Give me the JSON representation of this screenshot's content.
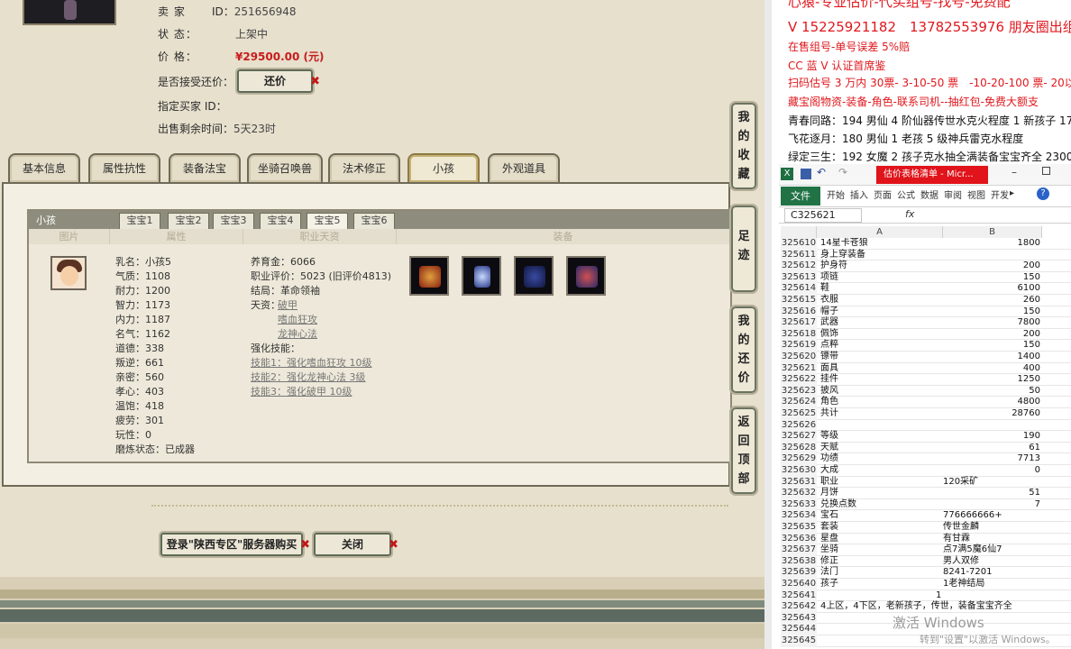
{
  "seller": {
    "label": "卖 家",
    "id_label": "ID：",
    "id": "251656948"
  },
  "status": {
    "label": "状 态：",
    "value": "上架中"
  },
  "price": {
    "label": "价 格：",
    "value": "¥29500.00 (元)"
  },
  "bargain": {
    "label": "是否接受还价：",
    "button": "还价"
  },
  "buyer": {
    "label": "指定买家 ID："
  },
  "remain": {
    "label": "出售剩余时间：",
    "value": "5天23时"
  },
  "tabs": [
    "基本信息",
    "属性抗性",
    "装备法宝",
    "坐骑召唤兽",
    "法术修正",
    "小孩",
    "外观道具"
  ],
  "kid": {
    "title": "小孩",
    "subtabs": [
      "宝宝1",
      "宝宝2",
      "宝宝3",
      "宝宝4",
      "宝宝5",
      "宝宝6"
    ],
    "columns": [
      "图片",
      "属性",
      "职业天资",
      "装备"
    ],
    "stats": [
      {
        "k": "乳名：",
        "v": "小孩5"
      },
      {
        "k": "气质：",
        "v": "1108"
      },
      {
        "k": "耐力：",
        "v": "1200"
      },
      {
        "k": "智力：",
        "v": "1173"
      },
      {
        "k": "内力：",
        "v": "1187"
      },
      {
        "k": "名气：",
        "v": "1162"
      },
      {
        "k": "道德：",
        "v": "338"
      },
      {
        "k": "叛逆：",
        "v": "661"
      },
      {
        "k": "亲密：",
        "v": "560"
      },
      {
        "k": "孝心：",
        "v": "403"
      },
      {
        "k": "温饱：",
        "v": "418"
      },
      {
        "k": "疲劳：",
        "v": "301"
      },
      {
        "k": "玩性：",
        "v": "0"
      },
      {
        "k": "磨炼状态：",
        "v": "已成器"
      }
    ],
    "career": {
      "money": {
        "k": "养育金：",
        "v": "6066"
      },
      "rating": {
        "k": "职业评价：",
        "v": "5023 (旧评价4813)"
      },
      "ending": {
        "k": "结局：",
        "v": "革命领袖"
      },
      "talent_label": "天资：",
      "talents": [
        "破甲",
        "嗜血狂攻",
        "龙神心法"
      ],
      "skill_label": "强化技能：",
      "skills": [
        "技能1：强化嗜血狂攻 10级",
        "技能2：强化龙神心法 3级",
        "技能3：强化破甲 10级"
      ]
    }
  },
  "buttons": {
    "buy": "登录\"陕西专区\"服务器购买",
    "close": "关闭"
  },
  "side_buttons": [
    "我的收藏",
    "足迹",
    "我的还价",
    "返回顶部"
  ],
  "ads": {
    "line0": "心猿-专业估价-代买组号-找号-免费配",
    "line1": "V 15225921182　13782553976 朋友圈出组号",
    "line2": "在售组号-单号误差 5%赔",
    "line3": "CC 蓝 V 认证首席鉴",
    "line4": "扫码估号 3 万内 30票- 3-10-50 票　-10-20-100 票- 20以上 150",
    "line5": "藏宝阁物资-装备-角色-联系司机--抽红包-免费大额支",
    "line6": "青春同路：194 男仙 4 阶仙器传世水克火程度 1 新孩子 17500",
    "line7": "飞花逐月：180 男仙 1 老孩 5 级神兵雷克水程度",
    "line8": "绿定三生：192 女魔 2 孩子克水抽全满装备宝宝齐全 23000"
  },
  "excel": {
    "title": "估价表格清单 - Micr...",
    "file_tab": "文件",
    "ribbon": [
      "开始",
      "插入",
      "页面",
      "公式",
      "数据",
      "审阅",
      "视图",
      "开发"
    ],
    "name_box": "C325621",
    "fx": "fx",
    "col_a": "A",
    "col_b": "B",
    "rows": [
      {
        "n": "325610",
        "a": "14星卡苍狼",
        "b": "1800"
      },
      {
        "n": "325611",
        "a": "身上穿装备",
        "b": ""
      },
      {
        "n": "325612",
        "a": "护身符",
        "b": "200"
      },
      {
        "n": "325613",
        "a": "项链",
        "b": "150"
      },
      {
        "n": "325614",
        "a": "鞋",
        "b": "6100"
      },
      {
        "n": "325615",
        "a": "衣服",
        "b": "260"
      },
      {
        "n": "325616",
        "a": "帽子",
        "b": "150"
      },
      {
        "n": "325617",
        "a": "武器",
        "b": "7800"
      },
      {
        "n": "325618",
        "a": "佩饰",
        "b": "200"
      },
      {
        "n": "325619",
        "a": "点粹",
        "b": "150"
      },
      {
        "n": "325620",
        "a": "镖带",
        "b": "1400"
      },
      {
        "n": "325621",
        "a": "面具",
        "b": "400"
      },
      {
        "n": "325622",
        "a": "挂件",
        "b": "1250"
      },
      {
        "n": "325623",
        "a": "披风",
        "b": "50"
      },
      {
        "n": "325624",
        "a": "角色",
        "b": "4800"
      },
      {
        "n": "325625",
        "a": "共计",
        "b": "28760"
      },
      {
        "n": "325626",
        "a": "",
        "b": ""
      },
      {
        "n": "325627",
        "a": "等级",
        "b": "190"
      },
      {
        "n": "325628",
        "a": "天赋",
        "b": "61"
      },
      {
        "n": "325629",
        "a": "功绩",
        "b": "7713"
      },
      {
        "n": "325630",
        "a": "大成",
        "b": "0"
      },
      {
        "n": "325631",
        "a": "职业",
        "b": "120采矿"
      },
      {
        "n": "325632",
        "a": "月饼",
        "b": "51"
      },
      {
        "n": "325633",
        "a": "兑换点数",
        "b": "7"
      },
      {
        "n": "325634",
        "a": "宝石",
        "b": "776666666+"
      },
      {
        "n": "325635",
        "a": "套装",
        "b": "传世金麟"
      },
      {
        "n": "325636",
        "a": "星盘",
        "b": "有甘霖"
      },
      {
        "n": "325637",
        "a": "坐骑",
        "b": "点7满5魔6仙7"
      },
      {
        "n": "325638",
        "a": "修正",
        "b": "男人双修"
      },
      {
        "n": "325639",
        "a": "法门",
        "b": "8241-7201"
      },
      {
        "n": "325640",
        "a": "孩子",
        "b": "1老神结局"
      },
      {
        "n": "325641",
        "a": "1",
        "b": ""
      },
      {
        "n": "325642",
        "a": "4上区，4下区，老新孩子，传世，装备宝宝齐全",
        "b": ""
      },
      {
        "n": "325643",
        "a": "",
        "b": ""
      },
      {
        "n": "325644",
        "a": "",
        "b": ""
      },
      {
        "n": "325645",
        "a": "",
        "b": ""
      }
    ]
  },
  "watermark": {
    "line1": "激活 Windows",
    "line2": "转到\"设置\"以激活 Windows。"
  }
}
